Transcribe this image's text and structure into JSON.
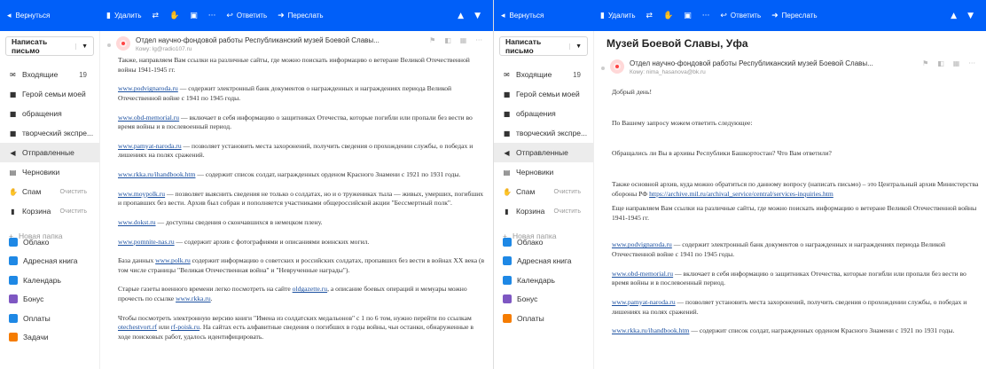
{
  "left": {
    "topbar": {
      "back": "Вернуться",
      "delete": "Удалить",
      "reply": "Ответить",
      "forward": "Переслать"
    },
    "compose": "Написать письмо",
    "nav": [
      {
        "label": "Входящие",
        "count": "19",
        "icon": "inbox-icon",
        "glyph": "✉"
      },
      {
        "label": "Герой семьи моей",
        "icon": "folder-icon",
        "glyph": "■"
      },
      {
        "label": "обращения",
        "icon": "folder-icon",
        "glyph": "■"
      },
      {
        "label": "творческий экспре...",
        "icon": "folder-icon",
        "glyph": "■"
      },
      {
        "label": "Отправленные",
        "icon": "sent-icon",
        "glyph": "◀"
      },
      {
        "label": "Черновики",
        "icon": "drafts-icon",
        "glyph": "▤"
      },
      {
        "label": "Спам",
        "clear": "Очистить",
        "icon": "spam-icon",
        "glyph": "✋"
      },
      {
        "label": "Корзина",
        "clear": "Очистить",
        "icon": "trash-icon",
        "glyph": "▮"
      }
    ],
    "new_folder": "Новая папка",
    "services": [
      {
        "label": "Облако",
        "color": "#1e88e5"
      },
      {
        "label": "Адресная книга",
        "color": "#1e88e5"
      },
      {
        "label": "Календарь",
        "color": "#1e88e5"
      },
      {
        "label": "Бонус",
        "color": "#7e57c2"
      },
      {
        "label": "Оплаты",
        "color": "#1e88e5"
      },
      {
        "label": "Задачи",
        "color": "#f57c00"
      }
    ],
    "sender": "Отдел научно-фондовой работы Республиканский музей Боевой Славы...",
    "to": "Кому: lg@radio107.ru",
    "body": {
      "intro": "Также, направляем Вам ссылки на различные сайты, где можно поискать информацию о ветеране Великой Отечественной войны 1941-1945 гг.",
      "links": [
        {
          "url": "www.podvignaroda.ru",
          "text": " — содержит электронный банк документов о награжденных и награждениях периода Великой Отечественной войне с 1941 по 1945 годы."
        },
        {
          "url": "www.obd-memorial.ru",
          "text": " — включает в себя информацию о защитниках Отечества, которые погибли или пропали без вести во время войны и в послевоенный период."
        },
        {
          "url": "www.pamyat-naroda.ru",
          "text": " — позволяет установить места захоронений, получить сведения о прохождении службы, о победах и лишениях на полях сражений."
        },
        {
          "url": "www.rkka.ru/ihandbook.htm",
          "text": " — содержит список солдат, награжденных орденом Красного Знамени с 1921 по 1931 годы."
        },
        {
          "url": "www.moypolk.ru",
          "text": " — позволяет выяснить сведения не только о солдатах, но и о тружениках тыла — живых, умерших, погибших и пропавших без вести. Архив был собран и пополняется участниками общероссийской акции \"Бессмертный полк\"."
        },
        {
          "url": "www.dokst.ru",
          "text": " — доступны сведения о скончавшихся в немецком плену."
        },
        {
          "url": "www.pomnite-nas.ru",
          "text": " — содержит архив с фотографиями и описаниями воинских могил."
        }
      ],
      "polk_pre": "База данных ",
      "polk_url": "www.polk.ru",
      "polk_post": " содержит информацию о советских и российских солдатах, пропавших без вести в войнах XX века (в том числе страницы \"Великая Отечественная война\" и \"Неврученные награды\").",
      "old_pre": "Старые газеты военного времени легко посмотреть на сайте ",
      "old_url1": "oldgazette.ru",
      "old_mid": ", а описание боевых операций и мемуары можно прочесть по ссылке ",
      "old_url2": "www.rkka.ru",
      "old_post": ".",
      "book_pre": "Чтобы посмотреть электронную версию книги \"Имена из солдатских медальонов\" с 1 по 6 том, нужно перейти по ссылкам ",
      "book_url1": "otechestvort.rf",
      "book_mid": " или ",
      "book_url2": "rf-poisk.ru",
      "book_post": ". На сайтах есть алфавитные сведения о погибших в годы войны, чьи останки, обнаруженные в ходе поисковых работ, удалось идентифицировать."
    }
  },
  "right": {
    "topbar": {
      "back": "Вернуться",
      "delete": "Удалить",
      "reply": "Ответить",
      "forward": "Переслать"
    },
    "compose": "Написать письмо",
    "nav": [
      {
        "label": "Входящие",
        "count": "19",
        "icon": "inbox-icon",
        "glyph": "✉"
      },
      {
        "label": "Герой семьи моей",
        "icon": "folder-icon",
        "glyph": "■"
      },
      {
        "label": "обращения",
        "icon": "folder-icon",
        "glyph": "■"
      },
      {
        "label": "творческий экспре...",
        "icon": "folder-icon",
        "glyph": "■"
      },
      {
        "label": "Отправленные",
        "icon": "sent-icon",
        "glyph": "◀"
      },
      {
        "label": "Черновики",
        "icon": "drafts-icon",
        "glyph": "▤"
      },
      {
        "label": "Спам",
        "clear": "Очистить",
        "icon": "spam-icon",
        "glyph": "✋"
      },
      {
        "label": "Корзина",
        "clear": "Очистить",
        "icon": "trash-icon",
        "glyph": "▮"
      }
    ],
    "new_folder": "Новая папка",
    "services": [
      {
        "label": "Облако",
        "color": "#1e88e5"
      },
      {
        "label": "Адресная книга",
        "color": "#1e88e5"
      },
      {
        "label": "Календарь",
        "color": "#1e88e5"
      },
      {
        "label": "Бонус",
        "color": "#7e57c2"
      },
      {
        "label": "Оплаты",
        "color": "#f57c00"
      }
    ],
    "subject": "Музей Боевой Славы, Уфа",
    "sender": "Отдел научно-фондовой работы Республиканский музей Боевой Славы...",
    "to": "Кому: nima_hasanova@bk.ru",
    "body": {
      "greeting": "Добрый день!",
      "answer": "По Вашему запросу можем ответить следующее:",
      "question": "Обращались ли Вы в архивы Республики Башкортостан? Что Вам ответили?",
      "archive_pre": "Также основной архив, куда можно обратиться по данному вопросу (написать письмо) – это Центральный архив Министерства обороны РФ ",
      "archive_url": "https://archive.mil.ru/archival_service/central/services-inquiries.htm",
      "more": "Еще направляем Вам ссылки на различные сайты, где можно поискать информацию о ветеране Великой Отечественной войны 1941-1945 гг.",
      "links": [
        {
          "url": "www.podvignaroda.ru",
          "text": " — содержит электронный банк документов о награжденных и награждениях периода Великой Отечественной войне с 1941 по 1945 годы."
        },
        {
          "url": "www.obd-memorial.ru",
          "text": " — включает в себя информацию о защитниках Отечества, которые погибли или пропали без вести во время войны и в послевоенный период."
        },
        {
          "url": "www.pamyat-naroda.ru",
          "text": " — позволяет установить места захоронений, получить сведения о прохождении службы, о победах и лишениях на полях сражений."
        },
        {
          "url": "www.rkka.ru/ihandbook.htm",
          "text": " — содержит список солдат, награжденных орденом Красного Знамени с 1921 по 1931 годы."
        }
      ]
    }
  }
}
